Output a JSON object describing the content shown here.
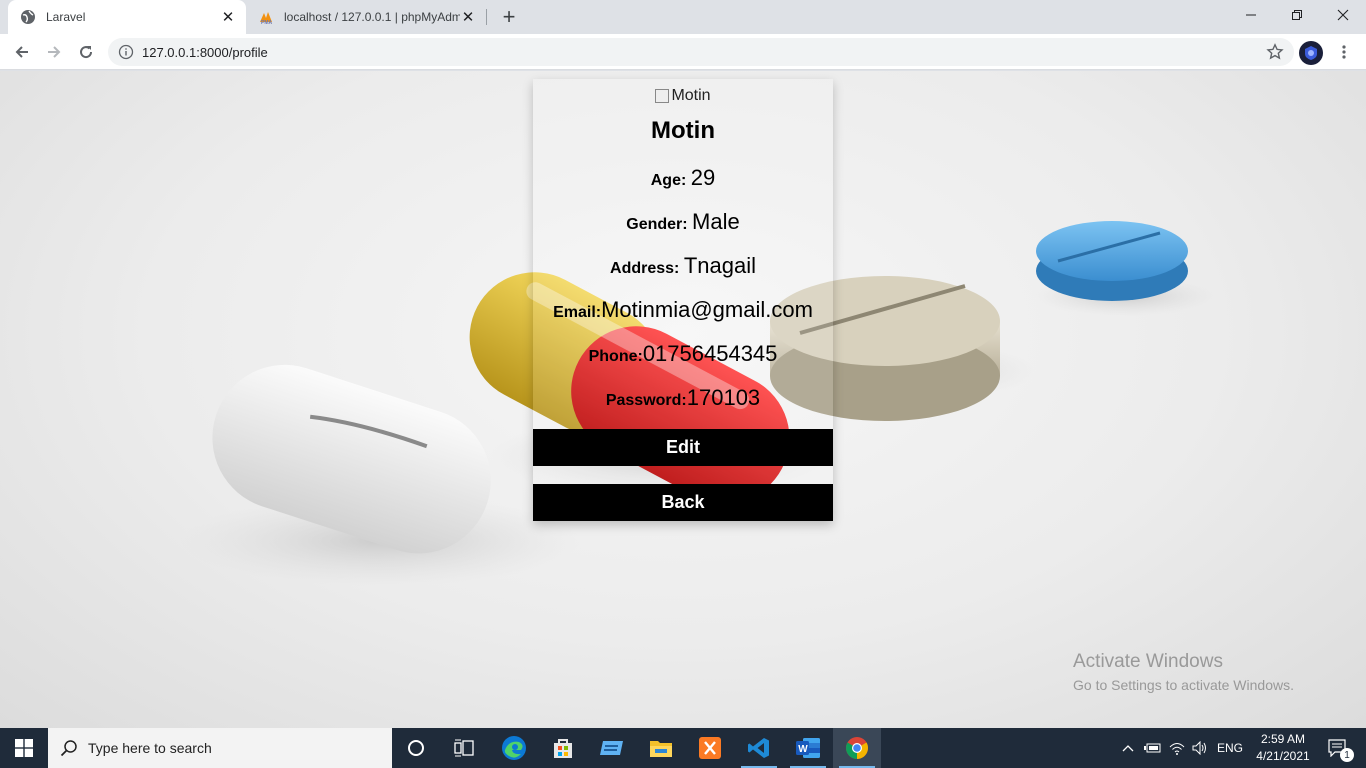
{
  "browser": {
    "tabs": [
      {
        "title": "Laravel",
        "active": true
      },
      {
        "title": "localhost / 127.0.0.1 | phpMyAdm",
        "active": false
      }
    ],
    "url": "127.0.0.1:8000/profile"
  },
  "profile": {
    "image_alt": "Motin",
    "name": "Motin",
    "age_label": "Age:",
    "age": "29",
    "gender_label": "Gender:",
    "gender": "Male",
    "address_label": "Address:",
    "address": "Tnagail",
    "email_label": "Email:",
    "email": "Motinmia@gmail.com",
    "phone_label": "Phone:",
    "phone": "01756454345",
    "password_label": "Password:",
    "password": "170103",
    "edit_label": "Edit",
    "back_label": "Back"
  },
  "watermark": {
    "title": "Activate Windows",
    "subtitle": "Go to Settings to activate Windows."
  },
  "taskbar": {
    "search_placeholder": "Type here to search",
    "language": "ENG",
    "time": "2:59 AM",
    "date": "4/21/2021",
    "notification_count": "1",
    "pinned": [
      "cortana-icon",
      "task-view-icon",
      "edge-icon",
      "store-icon",
      "onscreen-keyboard-icon",
      "file-explorer-icon",
      "xampp-icon",
      "vscode-icon",
      "word-icon",
      "chrome-icon"
    ]
  },
  "colors": {
    "button_bg": "#000000",
    "taskbar_bg": "#1f2b3a",
    "tab_strip": "#dee1e6"
  }
}
